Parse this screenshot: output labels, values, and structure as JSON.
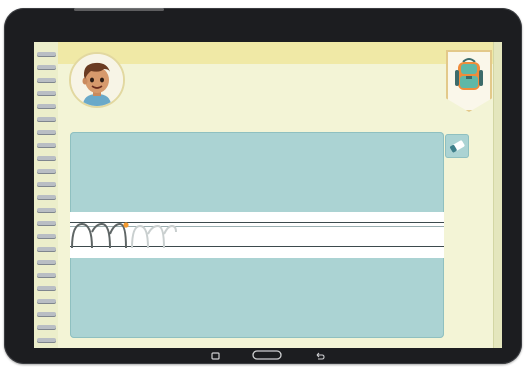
{
  "app": {
    "activity": "letter-tracing",
    "letters_traced": 2,
    "letters_total": 4
  },
  "icons": {
    "avatar": "boy-avatar",
    "badge": "backpack-icon",
    "tool": "eraser-icon",
    "nav": [
      "recent-apps-icon",
      "home-button",
      "back-icon"
    ]
  },
  "colors": {
    "panel": "#abd3d3",
    "page": "#f3f4d6",
    "top_strip": "#f0e9a6",
    "stroke_done": "#5e6565",
    "stroke_ghost": "#c9cfcf",
    "cursor_dot": "#f39a2f",
    "backpack_teal": "#5fb8a7",
    "backpack_orange": "#ef8c3b"
  }
}
